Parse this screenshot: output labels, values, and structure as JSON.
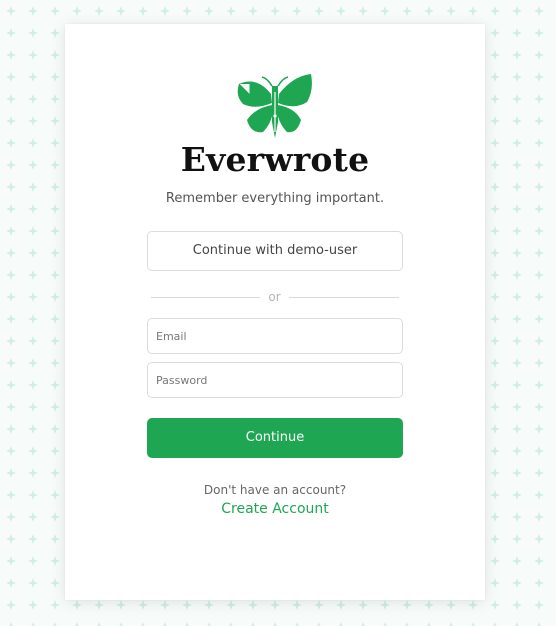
{
  "brand": {
    "name": "Everwrote",
    "tagline": "Remember everything important.",
    "logo_icon": "butterfly-quill-icon",
    "accent_color": "#1fa652"
  },
  "login": {
    "demo_button_label": "Continue with demo-user",
    "divider_text": "or",
    "email_placeholder": "Email",
    "password_placeholder": "Password",
    "continue_label": "Continue"
  },
  "signup": {
    "prompt": "Don't have an account?",
    "link_label": "Create Account"
  }
}
